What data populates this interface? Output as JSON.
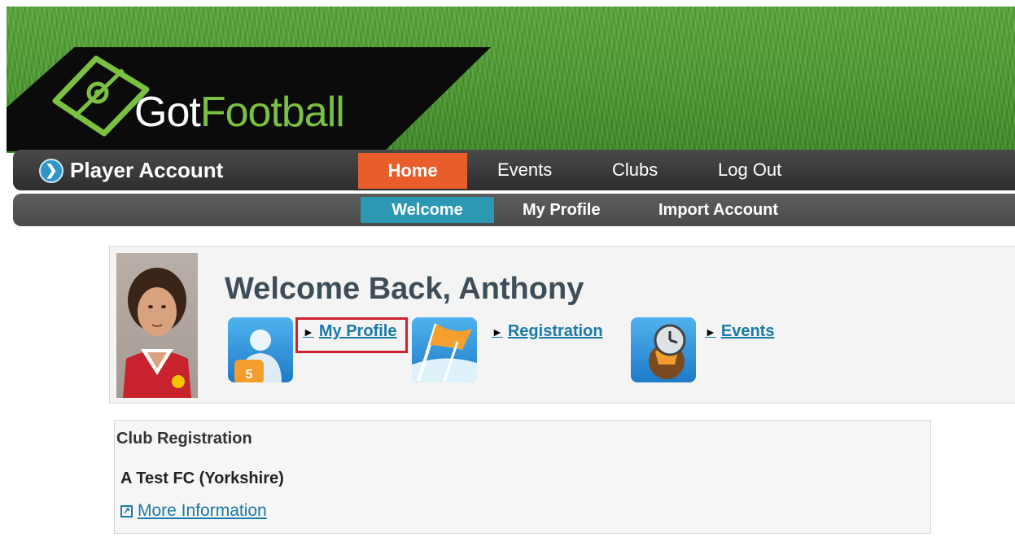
{
  "brand": {
    "name_part1": "Got",
    "name_part2": "Football"
  },
  "header": {
    "account_label": "Player Account",
    "tabs": [
      {
        "label": "Home",
        "active": true
      },
      {
        "label": "Events"
      },
      {
        "label": "Clubs"
      },
      {
        "label": "Log Out"
      }
    ],
    "subtabs": [
      {
        "label": "Welcome",
        "active": true
      },
      {
        "label": "My Profile"
      },
      {
        "label": "Import Account"
      }
    ]
  },
  "welcome": {
    "title": "Welcome Back, Anthony",
    "quick_links": [
      {
        "label": "My Profile",
        "icon": "player-shirt-icon"
      },
      {
        "label": "Registration",
        "icon": "flag-icon"
      },
      {
        "label": "Events",
        "icon": "clock-ball-icon"
      }
    ]
  },
  "club_registration": {
    "heading": "Club Registration",
    "club_name": "A Test FC (Yorkshire)",
    "more_info_label": "More Information"
  },
  "colors": {
    "accent_orange": "#e85d2a",
    "accent_teal": "#2c98b3",
    "link": "#1a7aa8",
    "brand_green": "#7ac142",
    "highlight_red": "#d0202e"
  }
}
